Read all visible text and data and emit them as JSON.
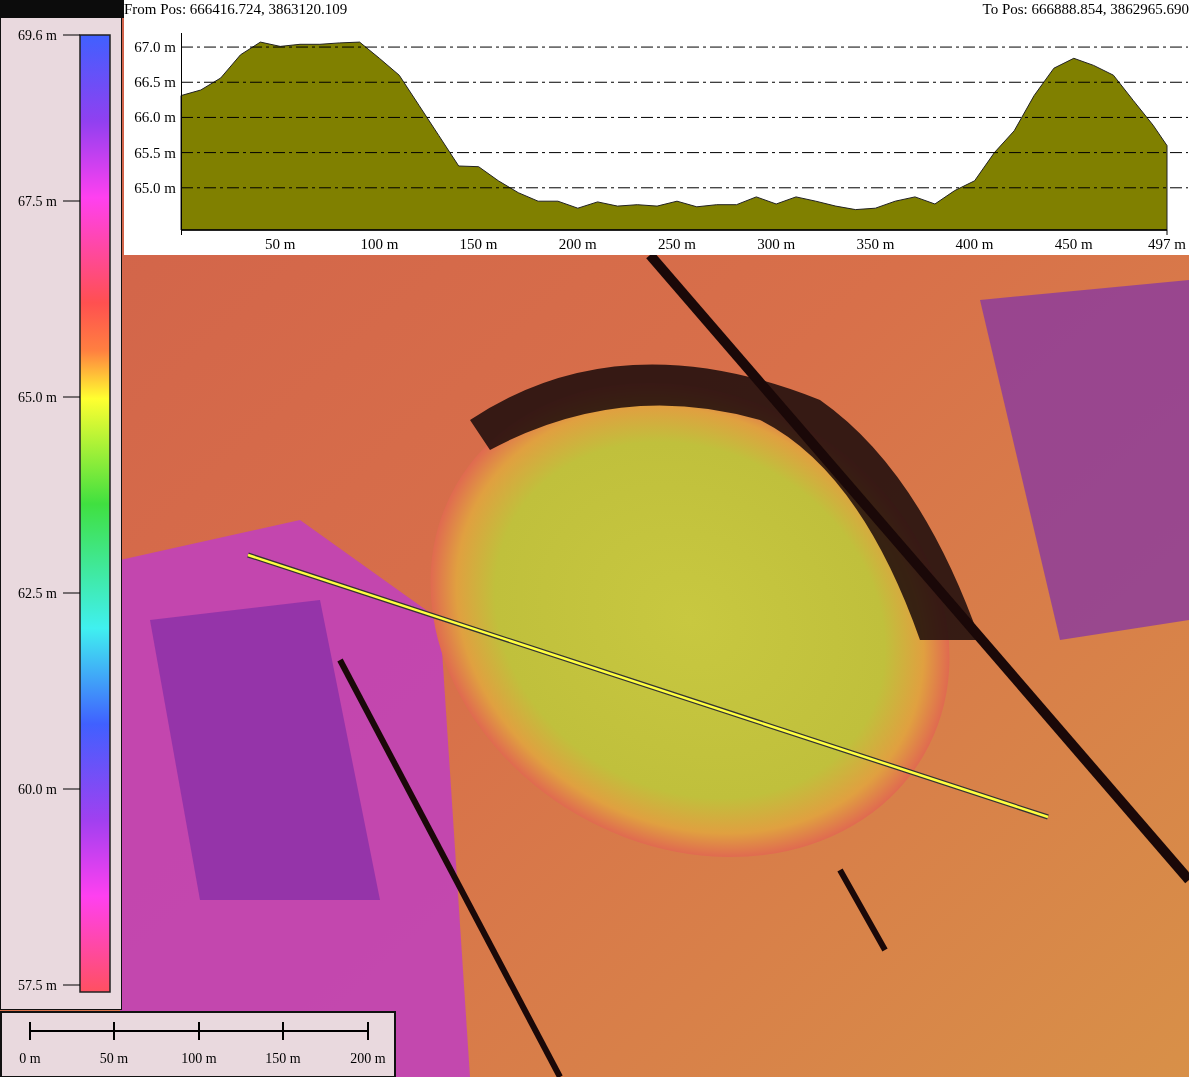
{
  "profile": {
    "from_label": "From Pos: 666416.724, 3863120.109",
    "to_label": "To Pos: 666888.854, 3862965.690",
    "chart_data": {
      "type": "area",
      "x": [
        0,
        10,
        20,
        30,
        40,
        50,
        60,
        70,
        80,
        90,
        100,
        110,
        120,
        130,
        140,
        150,
        160,
        170,
        180,
        190,
        200,
        210,
        220,
        230,
        240,
        250,
        260,
        270,
        280,
        290,
        300,
        310,
        320,
        330,
        340,
        350,
        360,
        370,
        380,
        390,
        400,
        410,
        420,
        430,
        440,
        450,
        460,
        470,
        480,
        490,
        497
      ],
      "series": [
        {
          "color": "#808000",
          "values": [
            66.31,
            66.39,
            66.56,
            66.89,
            67.07,
            67.01,
            67.04,
            67.04,
            67.06,
            67.07,
            66.84,
            66.6,
            66.17,
            65.74,
            65.31,
            65.3,
            65.1,
            64.93,
            64.81,
            64.81,
            64.71,
            64.8,
            64.74,
            64.76,
            64.74,
            64.81,
            64.73,
            64.76,
            64.76,
            64.87,
            64.77,
            64.87,
            64.81,
            64.74,
            64.69,
            64.71,
            64.81,
            64.87,
            64.77,
            64.96,
            65.1,
            65.5,
            65.81,
            66.31,
            66.7,
            66.84,
            66.74,
            66.6,
            66.24,
            65.89,
            65.6
          ]
        }
      ],
      "grid": true,
      "xlim": [
        0,
        497
      ],
      "ylim": [
        64.4,
        67.2
      ],
      "xticks": [
        {
          "value": 50,
          "label": "50 m"
        },
        {
          "value": 100,
          "label": "100 m"
        },
        {
          "value": 150,
          "label": "150 m"
        },
        {
          "value": 200,
          "label": "200 m"
        },
        {
          "value": 250,
          "label": "250 m"
        },
        {
          "value": 300,
          "label": "300 m"
        },
        {
          "value": 350,
          "label": "350 m"
        },
        {
          "value": 400,
          "label": "400 m"
        },
        {
          "value": 450,
          "label": "450 m"
        },
        {
          "value": 497,
          "label": "497 m"
        }
      ],
      "yticks": [
        {
          "value": 65,
          "label": "65.0 m"
        },
        {
          "value": 65.5,
          "label": "65.5 m"
        },
        {
          "value": 66,
          "label": "66.0 m"
        },
        {
          "value": 66.5,
          "label": "66.5 m"
        },
        {
          "value": 67,
          "label": "67.0 m"
        }
      ]
    }
  },
  "legend": {
    "ticks": [
      "69.6 m",
      "67.5 m",
      "65.0 m",
      "62.5 m",
      "60.0 m",
      "57.5 m"
    ]
  },
  "scale_bar": {
    "ticks": [
      "0 m",
      "50 m",
      "100 m",
      "150 m",
      "200 m"
    ]
  }
}
